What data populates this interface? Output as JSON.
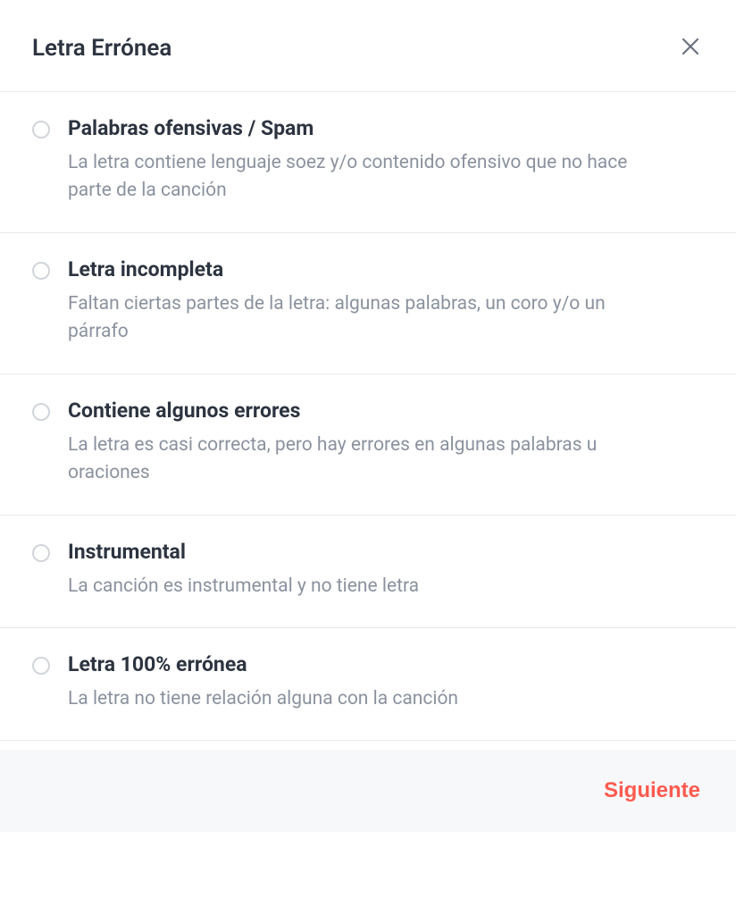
{
  "header": {
    "title": "Letra Errónea"
  },
  "options": [
    {
      "title": "Palabras ofensivas / Spam",
      "desc": "La letra contiene lenguaje soez y/o contenido ofensivo que no hace parte de la canción"
    },
    {
      "title": "Letra incompleta",
      "desc": "Faltan ciertas partes de la letra: algunas palabras, un coro y/o un párrafo"
    },
    {
      "title": "Contiene algunos errores",
      "desc": "La letra es casi correcta, pero hay errores en algunas palabras u oraciones"
    },
    {
      "title": "Instrumental",
      "desc": "La canción es instrumental y no tiene letra"
    },
    {
      "title": "Letra 100% errónea",
      "desc": "La letra no tiene relación alguna con la canción"
    }
  ],
  "footer": {
    "next_label": "Siguiente"
  }
}
